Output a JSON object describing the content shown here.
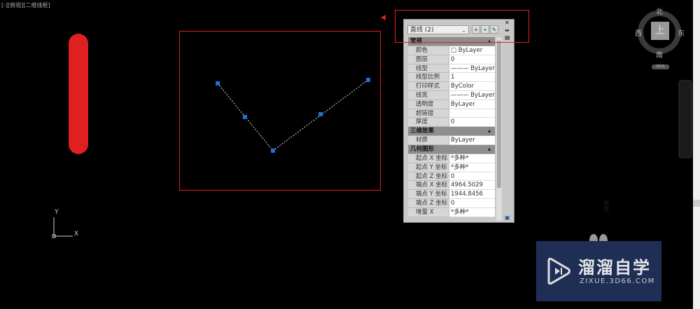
{
  "viewport": {
    "label": "[-][俯视][二维线框]"
  },
  "panel": {
    "selection": "直线 (2)",
    "side_label": "特性",
    "sections": [
      {
        "title": "常规",
        "rows": [
          [
            "颜色",
            "□ ByLayer"
          ],
          [
            "图层",
            "0"
          ],
          [
            "线型",
            "——— ByLayer"
          ],
          [
            "线型比例",
            "1"
          ],
          [
            "打印样式",
            "ByColor"
          ],
          [
            "线宽",
            "——— ByLayer"
          ],
          [
            "透明度",
            "ByLayer"
          ],
          [
            "超链接",
            ""
          ],
          [
            "厚度",
            "0"
          ]
        ]
      },
      {
        "title": "三维效果",
        "rows": [
          [
            "材质",
            "ByLayer"
          ]
        ]
      },
      {
        "title": "几何图形",
        "rows": [
          [
            "起点 X 坐标",
            "*多种*"
          ],
          [
            "起点 Y 坐标",
            "*多种*"
          ],
          [
            "起点 Z 坐标",
            "0"
          ],
          [
            "端点 X 坐标",
            "4964.5029"
          ],
          [
            "端点 Y 坐标",
            "1944.8456"
          ],
          [
            "端点 Z 坐标",
            "0"
          ],
          [
            "增量 X",
            "*多种*"
          ]
        ]
      }
    ]
  },
  "viewcube": {
    "north": "北",
    "south": "南",
    "east": "东",
    "west": "西",
    "face": "上",
    "wcs": "WCS"
  },
  "ucs": {
    "x": "X",
    "y": "Y"
  },
  "watermark": {
    "title": "溜溜自学",
    "url": "ZIXUE.3D66.COM"
  },
  "colors": {
    "annotation": "#e02020",
    "grip": "#1e6fd0",
    "watermark_bg": "#1f2e55"
  }
}
